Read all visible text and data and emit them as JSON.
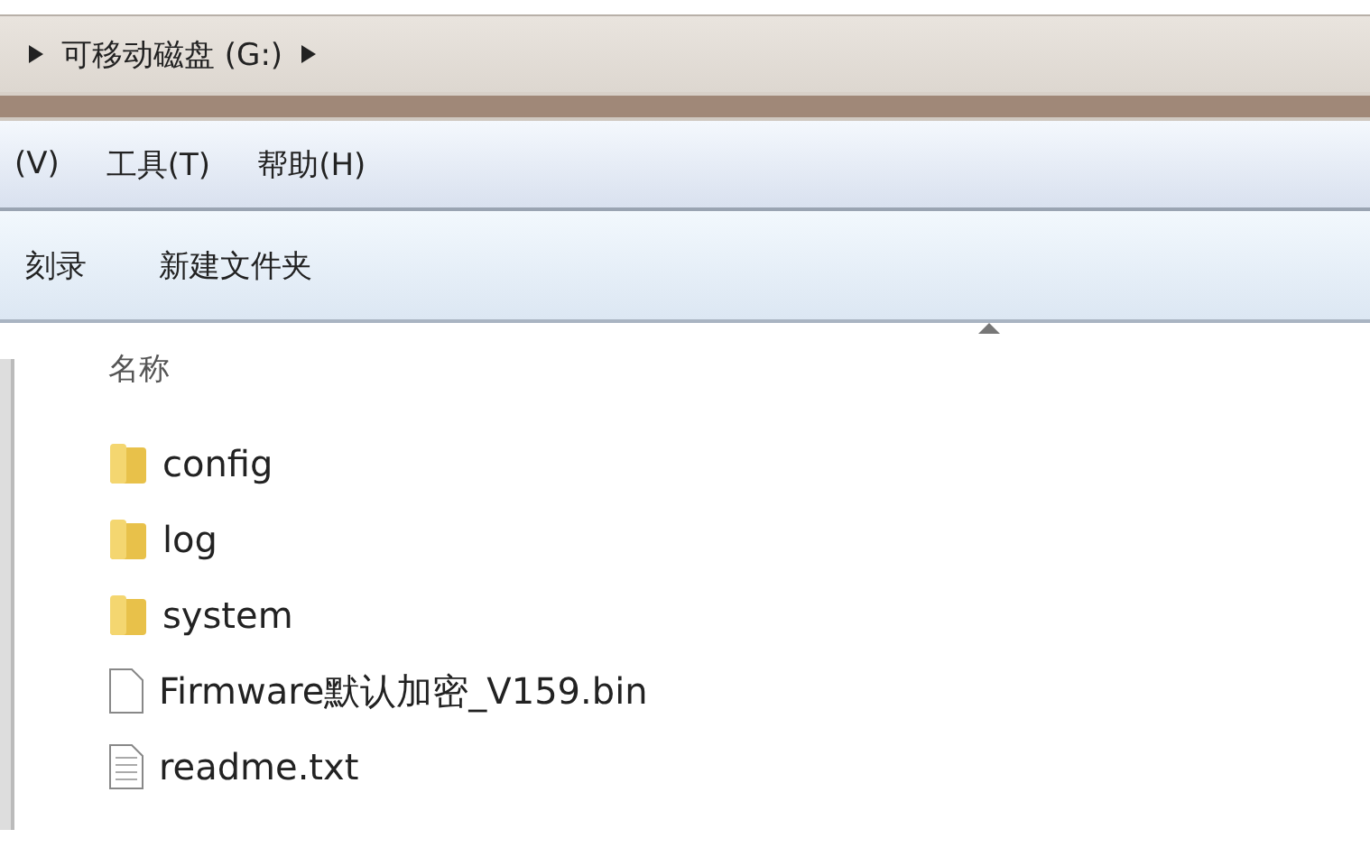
{
  "address_bar": {
    "segments": [
      "可移动磁盘 (G:)"
    ]
  },
  "menu_bar": [
    "(V)",
    "工具(T)",
    "帮助(H)"
  ],
  "toolbar": [
    "刻录",
    "新建文件夹"
  ],
  "file_list": {
    "column_header": "名称",
    "items": [
      {
        "name": "config",
        "kind": "folder"
      },
      {
        "name": "log",
        "kind": "folder"
      },
      {
        "name": "system",
        "kind": "folder"
      },
      {
        "name": "Firmware默认加密_V159.bin",
        "kind": "file"
      },
      {
        "name": "readme.txt",
        "kind": "text"
      }
    ]
  }
}
